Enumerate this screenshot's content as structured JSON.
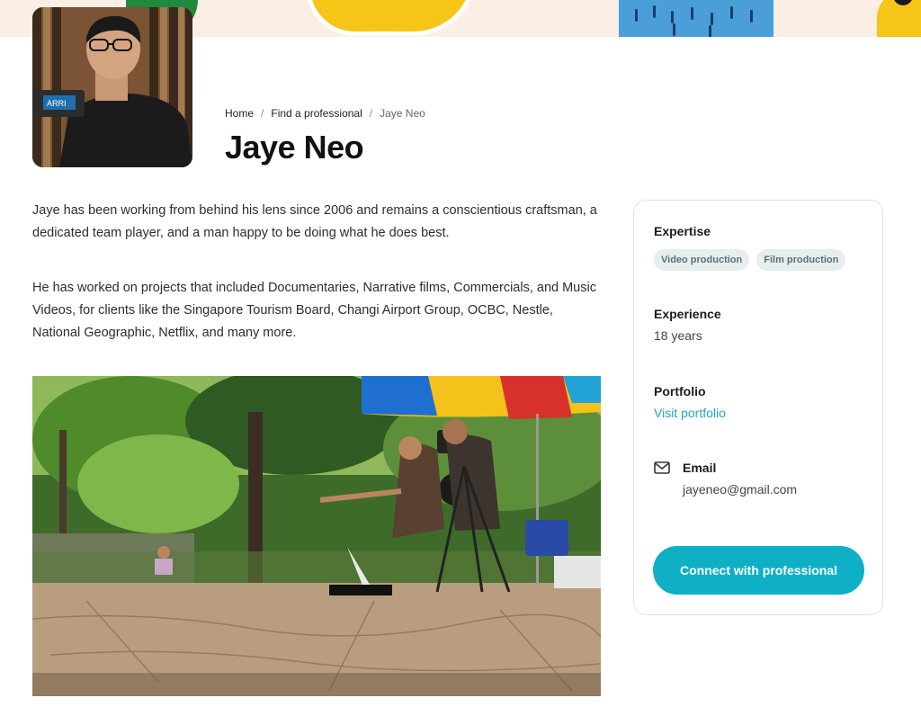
{
  "colors": {
    "accent": "#0fb0c6",
    "link": "#1ea7bd",
    "tag_bg": "#e6eef0",
    "tag_text": "#5b7078"
  },
  "breadcrumb": {
    "items": [
      "Home",
      "Find a professional",
      "Jaye Neo"
    ],
    "separator": "/"
  },
  "profile": {
    "name": "Jaye Neo",
    "bio": [
      "Jaye has been working from behind his lens since 2006 and remains a conscientious craftsman, a dedicated team player, and a man happy to be doing what he does best.",
      "He has worked on projects that included Documentaries, Narrative films, Commercials, and Music Videos, for clients like the Singapore Tourism Board, Changi Airport Group, OCBC, Nestle, National Geographic, Netflix, and many more."
    ]
  },
  "sidebar": {
    "expertise_label": "Expertise",
    "expertise_tags": [
      "Video production",
      "Film production"
    ],
    "experience_label": "Experience",
    "experience_value": "18 years",
    "portfolio_label": "Portfolio",
    "portfolio_link": "Visit portfolio",
    "email_label": "Email",
    "email_value": "jayeneo@gmail.com",
    "email_icon": "mail-icon",
    "connect_button": "Connect with professional"
  }
}
